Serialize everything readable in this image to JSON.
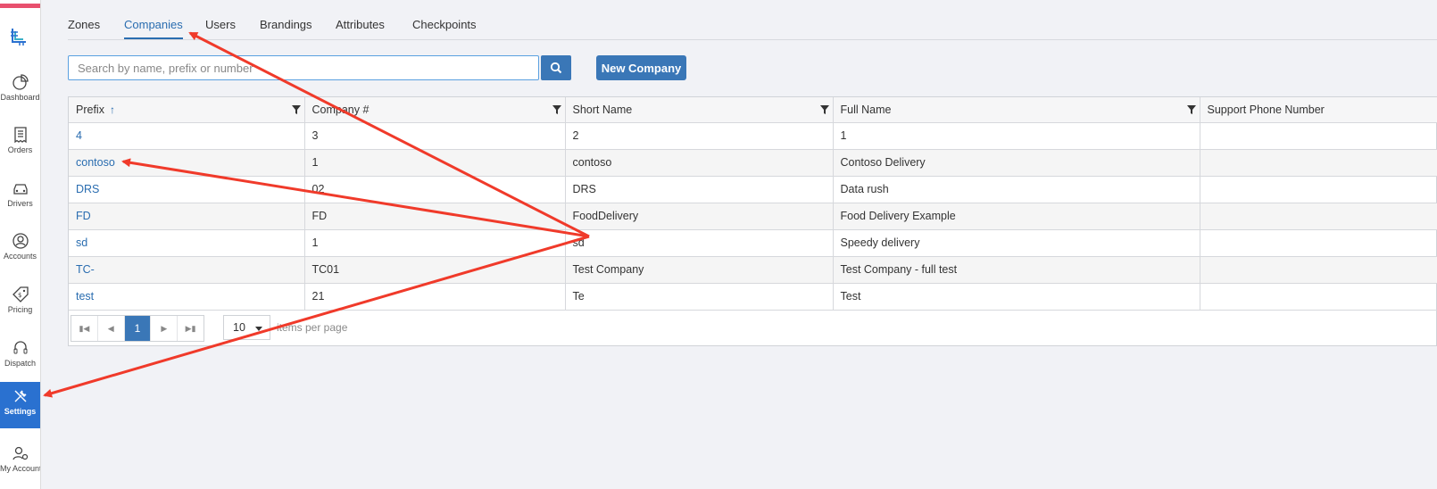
{
  "sidebar": {
    "items": [
      {
        "label": "Dashboard",
        "icon": "pie-chart-icon"
      },
      {
        "label": "Orders",
        "icon": "receipt-icon"
      },
      {
        "label": "Drivers",
        "icon": "car-icon"
      },
      {
        "label": "Accounts",
        "icon": "user-circle-icon"
      },
      {
        "label": "Pricing",
        "icon": "price-tag-icon"
      },
      {
        "label": "Dispatch",
        "icon": "headset-icon"
      },
      {
        "label": "Settings",
        "icon": "tools-icon"
      },
      {
        "label": "My Account",
        "icon": "user-gear-icon"
      }
    ]
  },
  "tabs": [
    "Zones",
    "Companies",
    "Users",
    "Brandings",
    "Attributes",
    "Checkpoints"
  ],
  "active_tab": "Companies",
  "search": {
    "placeholder": "Search by name, prefix or number",
    "value": ""
  },
  "buttons": {
    "new_company": "New Company"
  },
  "table": {
    "columns": [
      "Prefix",
      "Company #",
      "Short Name",
      "Full Name",
      "Support Phone Number"
    ],
    "rows": [
      {
        "prefix": "4",
        "number": "3",
        "short": "2",
        "full": "1",
        "phone": ""
      },
      {
        "prefix": "contoso",
        "number": "1",
        "short": "contoso",
        "full": "Contoso Delivery",
        "phone": ""
      },
      {
        "prefix": "DRS",
        "number": "02",
        "short": "DRS",
        "full": "Data rush",
        "phone": ""
      },
      {
        "prefix": "FD",
        "number": "FD",
        "short": "FoodDelivery",
        "full": "Food Delivery Example",
        "phone": ""
      },
      {
        "prefix": "sd",
        "number": "1",
        "short": "sd",
        "full": "Speedy delivery",
        "phone": ""
      },
      {
        "prefix": "TC-",
        "number": "TC01",
        "short": "Test Company",
        "full": "Test Company - full test",
        "phone": ""
      },
      {
        "prefix": "test",
        "number": "21",
        "short": "Te",
        "full": "Test",
        "phone": ""
      }
    ]
  },
  "pager": {
    "current_page": "1",
    "page_size": "10",
    "items_per_page_label": "items per page"
  },
  "colors": {
    "accent": "#3a77b7",
    "link": "#2a6db0",
    "annotation_arrow": "#f03a2a",
    "active_nav": "#2a71d0"
  }
}
